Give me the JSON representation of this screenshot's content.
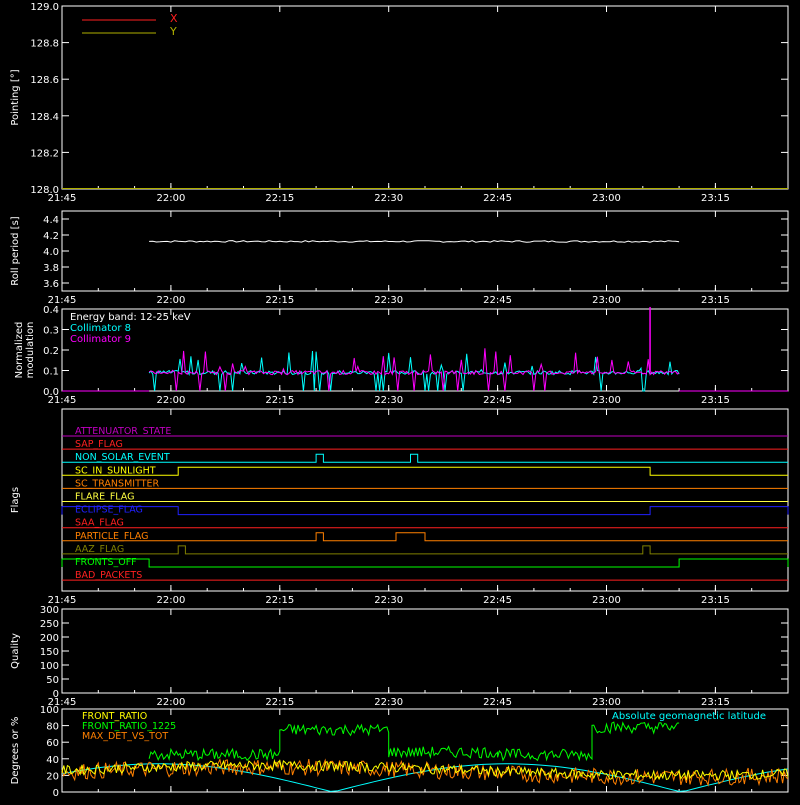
{
  "chart_data": [
    {
      "type": "line",
      "name": "pointing",
      "ylabel": "Pointing [°]",
      "ylim": [
        128.0,
        129.0
      ],
      "yticks": [
        "128.0",
        "128.2",
        "128.4",
        "128.6",
        "128.8",
        "129.0"
      ],
      "series": [
        {
          "name": "X",
          "color": "#ff2020",
          "values_constant": 128.0
        },
        {
          "name": "Y",
          "color": "#b0b000",
          "values_constant": 128.0
        }
      ],
      "xticks": [
        "21:45",
        "22:00",
        "22:15",
        "22:30",
        "22:45",
        "23:00",
        "23:15"
      ],
      "show_xtick_labels": true
    },
    {
      "type": "line",
      "name": "roll-period",
      "ylabel": "Roll period [s]",
      "ylim": [
        3.5,
        4.5
      ],
      "yticks": [
        "3.6",
        "3.8",
        "4.0",
        "4.2",
        "4.4"
      ],
      "series": [
        {
          "name": "Roll period",
          "color": "#ffffff",
          "level": 4.12
        }
      ],
      "xticks": [
        "21:45",
        "22:00",
        "22:15",
        "22:30",
        "22:45",
        "23:00",
        "23:15"
      ],
      "show_xtick_labels": true
    },
    {
      "type": "line",
      "name": "modulation",
      "ylabel_lines": [
        "Normalized",
        "modulation"
      ],
      "ylim": [
        0.0,
        0.4
      ],
      "yticks": [
        "0.0",
        "0.1",
        "0.2",
        "0.3",
        "0.4"
      ],
      "legend": [
        {
          "label": "Energy band: 12-25 keV",
          "color": "#ffffff"
        },
        {
          "label": "Collimator 8",
          "color": "#00ffff"
        },
        {
          "label": "Collimator 9",
          "color": "#ff00ff"
        }
      ],
      "x_range_data": [
        "21:57",
        "23:10"
      ],
      "baseline": 0.09,
      "spike_max": 0.41,
      "xticks": [
        "21:45",
        "22:00",
        "22:15",
        "22:30",
        "22:45",
        "23:00",
        "23:15"
      ],
      "show_xtick_labels": true
    },
    {
      "type": "table",
      "name": "flags",
      "ylabel": "Flags",
      "flags": [
        {
          "label": "ATTENUATOR_STATE",
          "color": "#c000c0",
          "on": []
        },
        {
          "label": "SAP_FLAG",
          "color": "#ff2020",
          "on": []
        },
        {
          "label": "NON_SOLAR_EVENT",
          "color": "#00ffff",
          "on": [
            [
              "22:20",
              "22:21"
            ],
            [
              "22:33",
              "22:34"
            ]
          ]
        },
        {
          "label": "SC_IN_SUNLIGHT",
          "color": "#ffff00",
          "on": [
            [
              "22:01",
              "23:06"
            ]
          ]
        },
        {
          "label": "SC_TRANSMITTER",
          "color": "#ff8000",
          "on": []
        },
        {
          "label": "FLARE_FLAG",
          "color": "#ffff40",
          "on": []
        },
        {
          "label": "ECLIPSE_FLAG",
          "color": "#2020ff",
          "on": [
            [
              "21:45",
              "22:01"
            ],
            [
              "23:06",
              "23:25"
            ]
          ]
        },
        {
          "label": "SAA_FLAG",
          "color": "#ff2020",
          "on": []
        },
        {
          "label": "PARTICLE_FLAG",
          "color": "#ff8000",
          "on": [
            [
              "22:20",
              "22:21"
            ],
            [
              "22:31",
              "22:35"
            ]
          ]
        },
        {
          "label": "AAZ_FLAG",
          "color": "#808000",
          "on": [
            [
              "22:01",
              "22:02"
            ],
            [
              "23:05",
              "23:06"
            ]
          ]
        },
        {
          "label": "FRONTS_OFF",
          "color": "#00ff00",
          "on": [
            [
              "21:45",
              "21:57"
            ],
            [
              "23:10",
              "23:25"
            ]
          ]
        },
        {
          "label": "BAD_PACKETS",
          "color": "#ff2020",
          "on": []
        }
      ],
      "xticks": [
        "21:45",
        "22:00",
        "22:15",
        "22:30",
        "22:45",
        "23:00",
        "23:15"
      ],
      "show_xtick_labels": true
    },
    {
      "type": "line",
      "name": "quality",
      "ylabel": "Quality",
      "ylim": [
        0,
        300
      ],
      "yticks": [
        "0",
        "50",
        "100",
        "150",
        "200",
        "250",
        "300"
      ],
      "series": [],
      "xticks": [
        "21:45",
        "22:00",
        "22:15",
        "22:30",
        "22:45",
        "23:00",
        "23:15"
      ],
      "show_xtick_labels": true
    },
    {
      "type": "line",
      "name": "ratios",
      "ylabel": "Degrees or %",
      "ylim": [
        0,
        100
      ],
      "yticks": [
        "0",
        "20",
        "40",
        "60",
        "80",
        "100"
      ],
      "series": [
        {
          "name": "FRONT_RATIO",
          "color": "#ffff00"
        },
        {
          "name": "FRONT_RATIO_1225",
          "color": "#00ff00"
        },
        {
          "name": "MAX_DET_VS_TOT",
          "color": "#ff8000"
        },
        {
          "name": "Absolute geomagnetic latitude",
          "color": "#00ffff"
        }
      ],
      "green_levels": [
        {
          "from": "21:57",
          "to": "22:15",
          "value": 45
        },
        {
          "from": "22:15",
          "to": "22:30",
          "value": 75
        },
        {
          "from": "22:30",
          "to": "22:45",
          "value": 48
        },
        {
          "from": "22:45",
          "to": "22:58",
          "value": 45
        },
        {
          "from": "22:58",
          "to": "23:10",
          "value": 78
        }
      ],
      "xticks": [
        "21:45",
        "22:00",
        "22:15",
        "22:30",
        "22:45",
        "23:00",
        "23:15"
      ],
      "show_xtick_labels": false
    }
  ]
}
